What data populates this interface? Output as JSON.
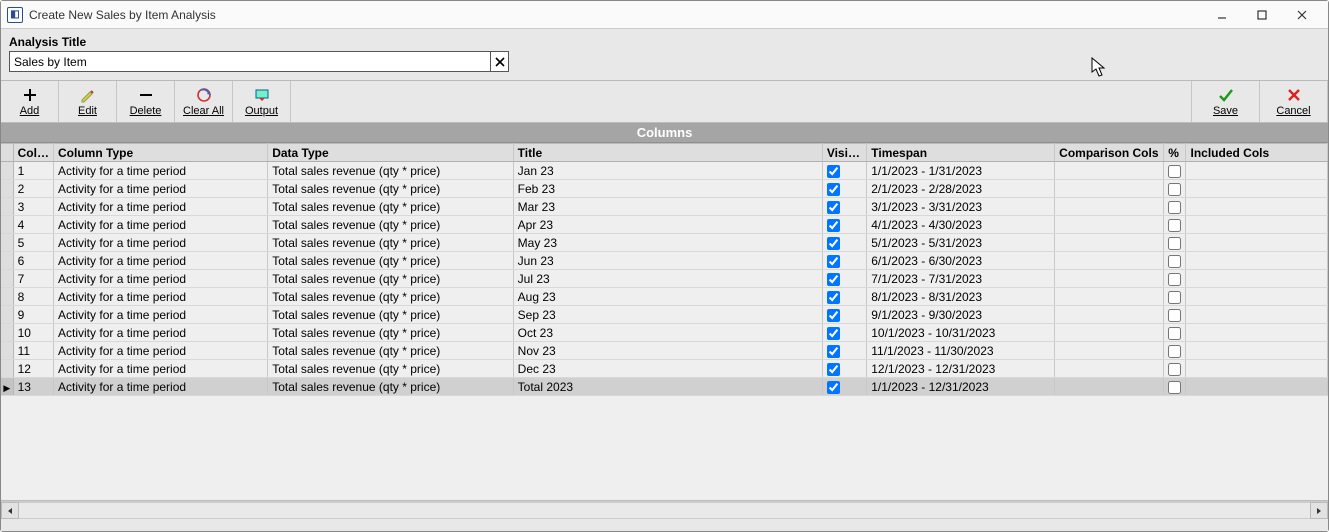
{
  "window_title": "Create New Sales by Item Analysis",
  "analysis": {
    "label": "Analysis Title",
    "value": "Sales by Item"
  },
  "toolbar": {
    "add": "Add",
    "edit": "Edit",
    "delete": "Delete",
    "clear_all": "Clear All",
    "output": "Output",
    "save": "Save",
    "cancel": "Cancel"
  },
  "columns_banner": "Columns",
  "grid": {
    "headers": {
      "col_id": "Col ID",
      "column_type": "Column Type",
      "data_type": "Data Type",
      "title": "Title",
      "visible": "Visible",
      "timespan": "Timespan",
      "comparison_cols": "Comparison Cols",
      "pct": "%",
      "included_cols": "Included Cols"
    },
    "rows": [
      {
        "col_id": "1",
        "column_type": "Activity for a time period",
        "data_type": "Total sales revenue (qty * price)",
        "title": "Jan 23",
        "visible": true,
        "timespan": "1/1/2023 - 1/31/2023",
        "comparison": "",
        "pct": false,
        "included": ""
      },
      {
        "col_id": "2",
        "column_type": "Activity for a time period",
        "data_type": "Total sales revenue (qty * price)",
        "title": "Feb 23",
        "visible": true,
        "timespan": "2/1/2023 - 2/28/2023",
        "comparison": "",
        "pct": false,
        "included": ""
      },
      {
        "col_id": "3",
        "column_type": "Activity for a time period",
        "data_type": "Total sales revenue (qty * price)",
        "title": "Mar 23",
        "visible": true,
        "timespan": "3/1/2023 - 3/31/2023",
        "comparison": "",
        "pct": false,
        "included": ""
      },
      {
        "col_id": "4",
        "column_type": "Activity for a time period",
        "data_type": "Total sales revenue (qty * price)",
        "title": "Apr 23",
        "visible": true,
        "timespan": "4/1/2023 - 4/30/2023",
        "comparison": "",
        "pct": false,
        "included": ""
      },
      {
        "col_id": "5",
        "column_type": "Activity for a time period",
        "data_type": "Total sales revenue (qty * price)",
        "title": "May 23",
        "visible": true,
        "timespan": "5/1/2023 - 5/31/2023",
        "comparison": "",
        "pct": false,
        "included": ""
      },
      {
        "col_id": "6",
        "column_type": "Activity for a time period",
        "data_type": "Total sales revenue (qty * price)",
        "title": "Jun 23",
        "visible": true,
        "timespan": "6/1/2023 - 6/30/2023",
        "comparison": "",
        "pct": false,
        "included": ""
      },
      {
        "col_id": "7",
        "column_type": "Activity for a time period",
        "data_type": "Total sales revenue (qty * price)",
        "title": "Jul 23",
        "visible": true,
        "timespan": "7/1/2023 - 7/31/2023",
        "comparison": "",
        "pct": false,
        "included": ""
      },
      {
        "col_id": "8",
        "column_type": "Activity for a time period",
        "data_type": "Total sales revenue (qty * price)",
        "title": "Aug 23",
        "visible": true,
        "timespan": "8/1/2023 - 8/31/2023",
        "comparison": "",
        "pct": false,
        "included": ""
      },
      {
        "col_id": "9",
        "column_type": "Activity for a time period",
        "data_type": "Total sales revenue (qty * price)",
        "title": "Sep 23",
        "visible": true,
        "timespan": "9/1/2023 - 9/30/2023",
        "comparison": "",
        "pct": false,
        "included": ""
      },
      {
        "col_id": "10",
        "column_type": "Activity for a time period",
        "data_type": "Total sales revenue (qty * price)",
        "title": "Oct 23",
        "visible": true,
        "timespan": "10/1/2023 - 10/31/2023",
        "comparison": "",
        "pct": false,
        "included": ""
      },
      {
        "col_id": "11",
        "column_type": "Activity for a time period",
        "data_type": "Total sales revenue (qty * price)",
        "title": "Nov 23",
        "visible": true,
        "timespan": "11/1/2023 - 11/30/2023",
        "comparison": "",
        "pct": false,
        "included": ""
      },
      {
        "col_id": "12",
        "column_type": "Activity for a time period",
        "data_type": "Total sales revenue (qty * price)",
        "title": "Dec 23",
        "visible": true,
        "timespan": "12/1/2023 - 12/31/2023",
        "comparison": "",
        "pct": false,
        "included": ""
      },
      {
        "col_id": "13",
        "column_type": "Activity for a time period",
        "data_type": "Total sales revenue (qty * price)",
        "title": "Total 2023",
        "visible": true,
        "timespan": "1/1/2023 - 12/31/2023",
        "comparison": "",
        "pct": false,
        "included": "",
        "selected": true
      }
    ]
  }
}
